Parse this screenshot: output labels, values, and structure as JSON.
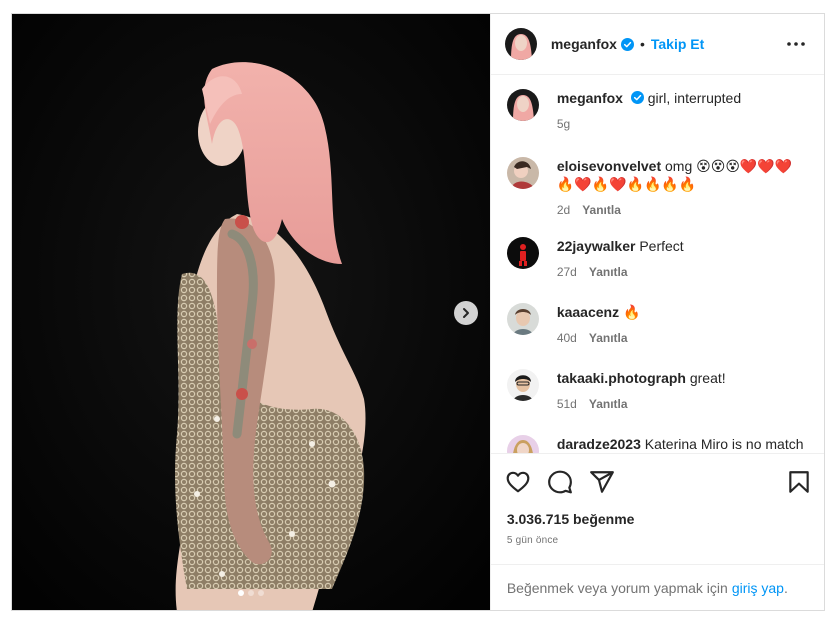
{
  "colors": {
    "accent": "#0095f6",
    "text": "#262626",
    "muted": "#737373",
    "border": "#dbdbdb"
  },
  "header": {
    "username": "meganfox",
    "separator": "•",
    "follow_label": "Takip Et",
    "more_icon": "more-horizontal-icon"
  },
  "caption": {
    "username": "meganfox",
    "text": "girl, interrupted",
    "age": "5g"
  },
  "comments": [
    {
      "username": "eloisevonvelvet",
      "text": "omg 😵😵😵❤️❤️❤️🔥❤️🔥❤️🔥🔥🔥🔥",
      "age": "2d",
      "reply": "Yanıtla"
    },
    {
      "username": "22jaywalker",
      "text": "Perfect",
      "age": "27d",
      "reply": "Yanıtla"
    },
    {
      "username": "kaaacenz",
      "text": "🔥",
      "age": "40d",
      "reply": "Yanıtla"
    },
    {
      "username": "takaaki.photograph",
      "text": "great!",
      "age": "51d",
      "reply": "Yanıtla"
    },
    {
      "username": "daradze2023",
      "text": "Katerina Miro is no match for Colson Baker",
      "age": "",
      "reply": ""
    }
  ],
  "actions": {
    "like_icon": "heart-icon",
    "comment_icon": "comment-icon",
    "share_icon": "send-icon",
    "save_icon": "bookmark-icon"
  },
  "likes_text": "3.036.715 beğenme",
  "post_time": "5 gün önce",
  "login_prompt": {
    "prefix": "Beğenmek veya yorum yapmak için",
    "link": "giriş yap",
    "suffix": "."
  },
  "carousel": {
    "slide_count": 3,
    "active_index": 0
  }
}
